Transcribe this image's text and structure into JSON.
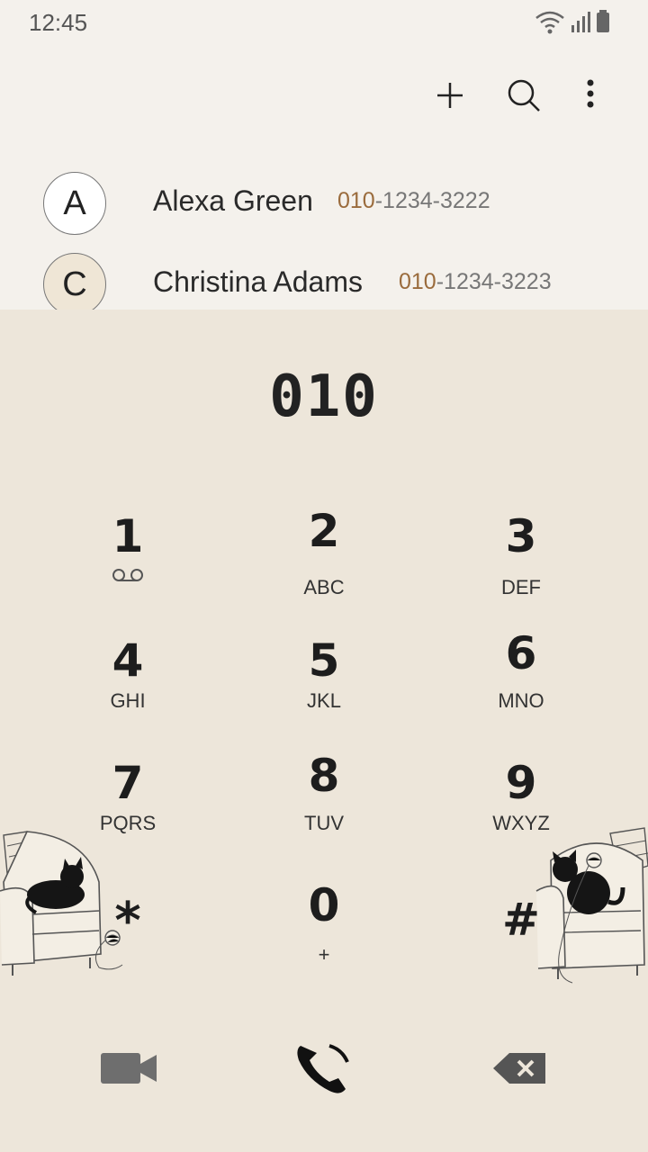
{
  "status_bar": {
    "time": "12:45",
    "icons": [
      "wifi-icon",
      "signal-icon",
      "battery-icon"
    ]
  },
  "toolbar": {
    "icons": [
      "add-icon",
      "search-icon",
      "more-vert-icon"
    ]
  },
  "contacts": [
    {
      "initial": "A",
      "name": "Alexa Green",
      "number_match": "010",
      "number_rest": "-1234-3222"
    },
    {
      "initial": "C",
      "name": "Christina Adams",
      "number_match": "010",
      "number_rest": "-1234-3223"
    }
  ],
  "dialpad": {
    "dialed_number": "010",
    "keys": [
      {
        "digit": "1",
        "letters": ""
      },
      {
        "digit": "2",
        "letters": "ABC"
      },
      {
        "digit": "3",
        "letters": "DEF"
      },
      {
        "digit": "4",
        "letters": "GHI"
      },
      {
        "digit": "5",
        "letters": "JKL"
      },
      {
        "digit": "6",
        "letters": "MNO"
      },
      {
        "digit": "7",
        "letters": "PQRS"
      },
      {
        "digit": "8",
        "letters": "TUV"
      },
      {
        "digit": "9",
        "letters": "WXYZ"
      },
      {
        "digit": "*",
        "letters": ""
      },
      {
        "digit": "0",
        "letters": "+"
      },
      {
        "digit": "#",
        "letters": ""
      }
    ]
  },
  "actions": [
    "video-call-icon",
    "call-icon",
    "backspace-icon"
  ],
  "colors": {
    "background": "#f4f1ec",
    "dialpad_background": "#ede6da",
    "number_match": "#9a6b3c",
    "text": "#222222"
  }
}
